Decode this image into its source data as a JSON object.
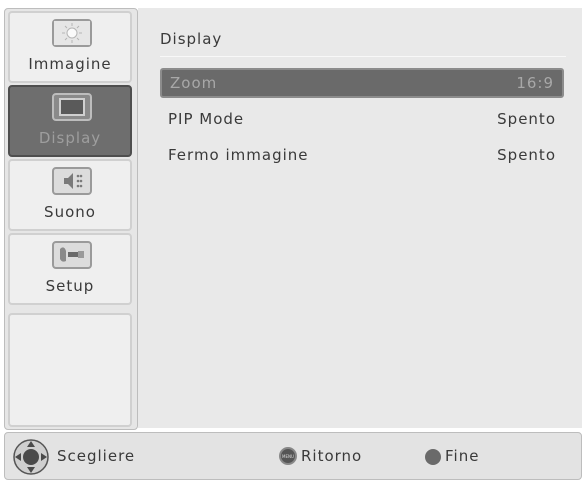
{
  "sidebar": {
    "items": [
      {
        "label": "Immagine",
        "icon": "picture-sun-icon"
      },
      {
        "label": "Display",
        "icon": "monitor-icon"
      },
      {
        "label": "Suono",
        "icon": "speaker-icon"
      },
      {
        "label": "Setup",
        "icon": "setup-tools-icon"
      }
    ],
    "active_index": 1
  },
  "main": {
    "title": "Display",
    "rows": [
      {
        "label": "Zoom",
        "value": "16:9",
        "selected": true
      },
      {
        "label": "PIP Mode",
        "value": "Spento",
        "selected": false
      },
      {
        "label": "Fermo immagine",
        "value": "Spento",
        "selected": false
      }
    ]
  },
  "footer": {
    "select_label": "Scegliere",
    "return_label": "Ritorno",
    "return_key": "MENU",
    "exit_label": "Fine"
  },
  "colors": {
    "panel": "#e9e9e9",
    "selected_bg": "#6a6a6a",
    "text": "#3a3a3a"
  }
}
